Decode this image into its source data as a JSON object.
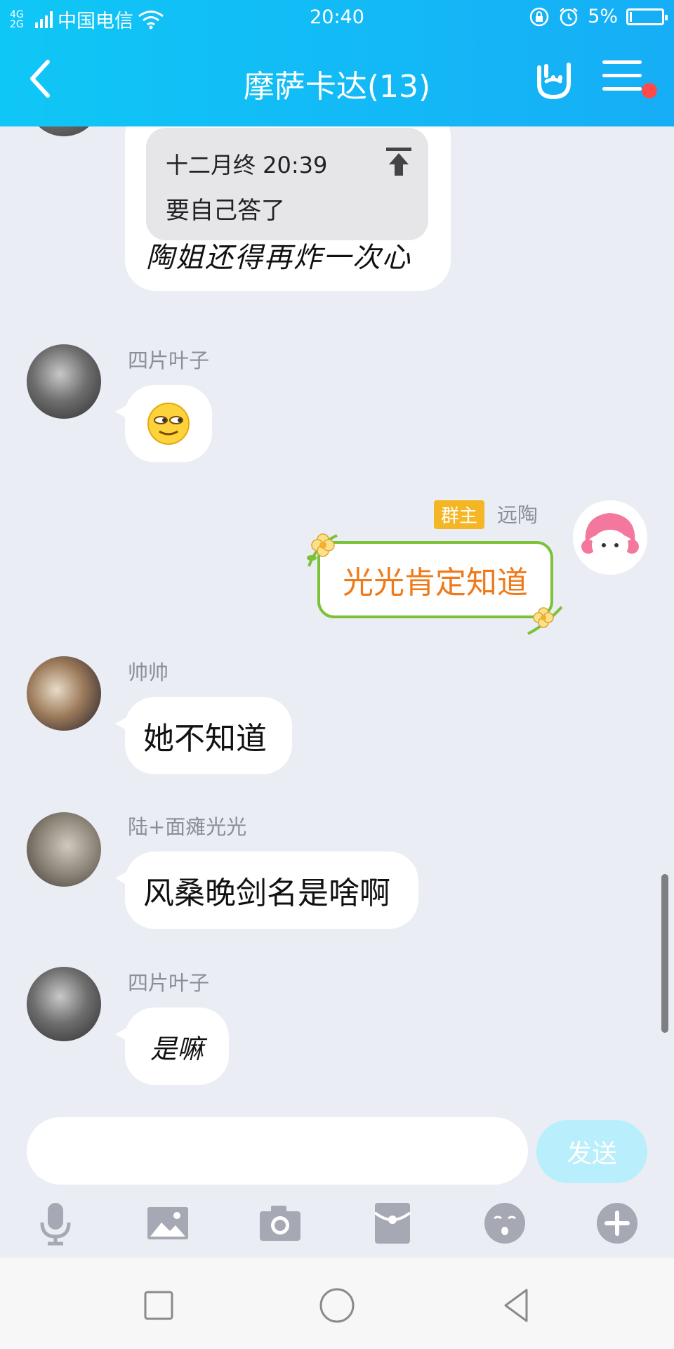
{
  "status_bar": {
    "network_label": "4G 2G",
    "carrier": "中国电信",
    "time": "20:40",
    "battery_percent": "5%",
    "battery_level": 0.05
  },
  "header": {
    "title": "摩萨卡达(13)"
  },
  "messages": {
    "m1": {
      "quote_meta": "十二月终 20:39",
      "quote_text": "要自己答了",
      "text": "陶姐还得再炸一次心"
    },
    "m2": {
      "sender": "四片叶子"
    },
    "m3": {
      "badge": "群主",
      "sender": "远陶",
      "text": "光光肯定知道"
    },
    "m4": {
      "sender": "帅帅",
      "text": "她不知道"
    },
    "m5": {
      "sender": "陆+面瘫光光",
      "text": "风桑晚剑名是啥啊"
    },
    "m6": {
      "sender": "四片叶子",
      "text": "是嘛"
    }
  },
  "composer": {
    "input_value": "",
    "send_label": "发送"
  },
  "toolbar": {
    "icons": [
      "microphone-icon",
      "image-icon",
      "camera-icon",
      "red-packet-icon",
      "emoji-icon",
      "plus-icon"
    ]
  },
  "colors": {
    "header_start": "#0fc7f6",
    "header_end": "#16aef6",
    "chat_bg": "#eaedf4",
    "owner_badge": "#f5b625",
    "special_text": "#f07a1a",
    "send_button": "#b9eefc"
  }
}
